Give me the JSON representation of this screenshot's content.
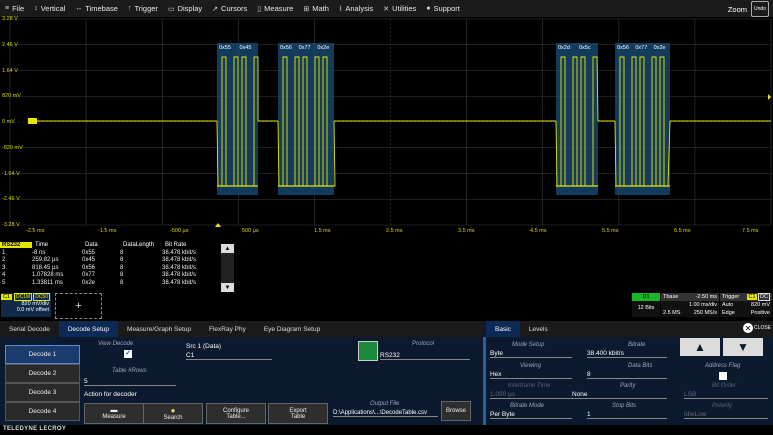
{
  "menu": {
    "items": [
      {
        "label": "File",
        "icon": "≡"
      },
      {
        "label": "Vertical",
        "icon": "↕"
      },
      {
        "label": "Timebase",
        "icon": "↔"
      },
      {
        "label": "Trigger",
        "icon": "↑"
      },
      {
        "label": "Display",
        "icon": "▭"
      },
      {
        "label": "Cursors",
        "icon": "↗"
      },
      {
        "label": "Measure",
        "icon": "▯"
      },
      {
        "label": "Math",
        "icon": "⊞"
      },
      {
        "label": "Analysis",
        "icon": "⌇"
      },
      {
        "label": "Utilities",
        "icon": "✕"
      },
      {
        "label": "Support",
        "icon": "●"
      }
    ],
    "zoom_label": "Zoom",
    "undo_label": "Undo"
  },
  "grid": {
    "v_labels": [
      "3.28 V",
      "2.46 V",
      "1.64 V",
      "820 mV",
      "0 mV",
      "-820 mV",
      "-1.64 V",
      "-2.46 V",
      "-3.28 V"
    ],
    "h_labels": [
      "-2.5 ms",
      "-1.5 ms",
      "-500 µs",
      "500 µs",
      "1.5 ms",
      "2.5 ms",
      "3.5 ms",
      "4.5 ms",
      "5.5 ms",
      "6.5 ms",
      "7.5 ms"
    ],
    "packet_labels": [
      "0x55",
      "0x45",
      "0x56",
      "0x77",
      "0x2e",
      "0x2d",
      "0x5c",
      "0x56",
      "0x77",
      "0x2e"
    ],
    "trace_color": "#e6e600",
    "annotation_color": "#1a4f7a"
  },
  "decode_table": {
    "title": "RS232",
    "headers": [
      "Time",
      "Data",
      "DataLength",
      "Bit Rate"
    ],
    "rows": [
      {
        "idx": "1",
        "time": "-8 ns",
        "data": "0x55",
        "len": "8",
        "rate": "38.478 kbit/s"
      },
      {
        "idx": "2",
        "time": "259.82 µs",
        "data": "0x45",
        "len": "8",
        "rate": "38.478 kbit/s"
      },
      {
        "idx": "3",
        "time": "818.45 µs",
        "data": "0x56",
        "len": "8",
        "rate": "38.478 kbit/s"
      },
      {
        "idx": "4",
        "time": "1.07828 ms",
        "data": "0x77",
        "len": "8",
        "rate": "38.478 kbit/s"
      },
      {
        "idx": "5",
        "time": "1.33811 ms",
        "data": "0x2e",
        "len": "8",
        "rate": "38.478 kbit/s"
      }
    ]
  },
  "channel": {
    "name": "C1",
    "coupling": "DC1M",
    "coupling2": "DC50",
    "vdiv": "820 mV/div",
    "offset": "0.0 mV offset",
    "add_symbol": "+"
  },
  "status": {
    "decoder_badge": "D1",
    "bits": "12 Bits",
    "tbase_label": "Tbase",
    "tbase_value": "-2.50 ms",
    "tbase_div": "1.00 ms/div",
    "tbase_samples": "2.5 MS",
    "tbase_rate": "250 MS/s",
    "trig_label": "Trigger",
    "trig_ch": "C1",
    "trig_coupling": "DC",
    "trig_mode": "Auto",
    "trig_level": "820 mV",
    "trig_type": "Edge",
    "trig_slope": "Positive"
  },
  "tabs": {
    "left": [
      "Serial Decode",
      "Decode Setup",
      "Measure/Graph Setup",
      "FlexRay Phy",
      "Eye Diagram Setup"
    ],
    "right": [
      "Basic",
      "Levels"
    ],
    "close_label": "CLOSE"
  },
  "decoders": [
    "Decode 1",
    "Decode 2",
    "Decode 3",
    "Decode 4"
  ],
  "setup": {
    "view_decode_label": "View Decode",
    "src_label": "Src 1 (Data)",
    "src_value": "C1",
    "table_rows_label": "Table #Rows",
    "table_rows_value": "5",
    "action_label": "Action for decoder",
    "protocol_label": "Protocol",
    "protocol_value": "RS232",
    "output_file_label": "Output File",
    "output_file_value": "D:\\Applications\\...\\DecodeTable.csv",
    "buttons": [
      "Measure",
      "Search",
      "Configure Table...",
      "Export Table",
      "Browse"
    ]
  },
  "basic": {
    "mode_setup_label": "Mode Setup",
    "mode_setup_value": "Byte",
    "bitrate_label": "Bitrate",
    "bitrate_value": "38.400 kbit/s",
    "viewing_label": "Viewing",
    "viewing_value": "Hex",
    "data_bits_label": "Data Bits",
    "data_bits_value": "8",
    "address_flag_label": "Address Flag",
    "interframe_label": "Interframe Time",
    "interframe_value": "1.000 µs",
    "parity_label": "Parity",
    "parity_value": "None",
    "bit_order_label": "Bit Order",
    "bit_order_value": "LSB",
    "bitrate_mode_label": "Bitrate Mode",
    "bitrate_mode_value": "Per Byte",
    "stop_bits_label": "Stop Bits",
    "stop_bits_value": "1",
    "polarity_label": "Polarity",
    "polarity_value": "IdleLow"
  },
  "brand": "TELEDYNE LECROY"
}
